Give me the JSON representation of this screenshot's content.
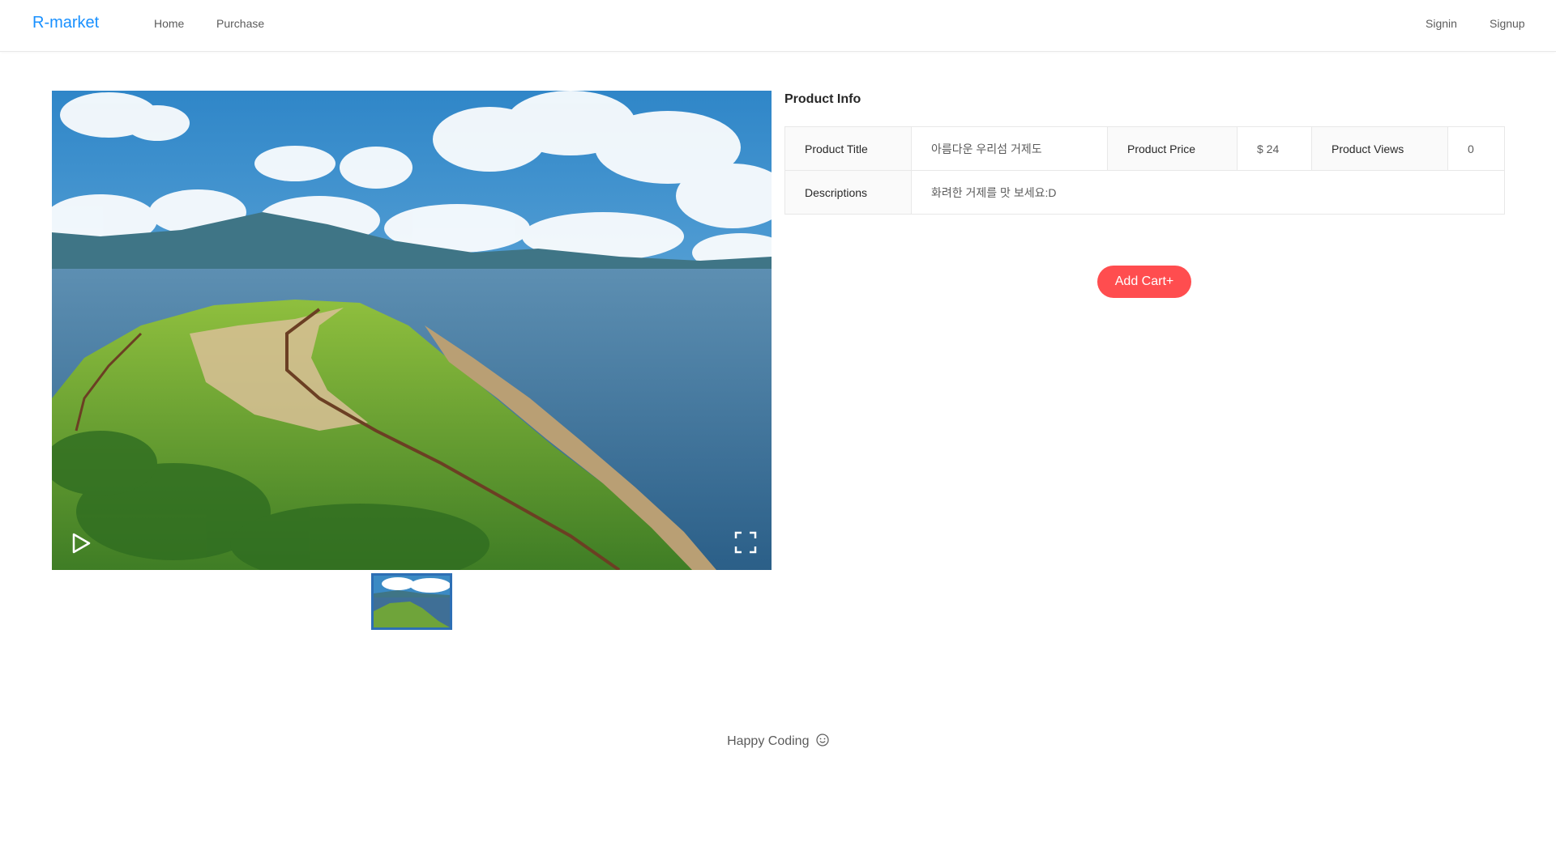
{
  "header": {
    "logo": "R-market",
    "nav": {
      "home": "Home",
      "purchase": "Purchase"
    },
    "auth": {
      "signin": "Signin",
      "signup": "Signup"
    },
    "accent": "#1890ff"
  },
  "media": {
    "play_icon": "play-icon",
    "fullscreen_icon": "fullscreen-icon",
    "thumbnail_selected_color": "#2d6fb5"
  },
  "product": {
    "section_title": "Product Info",
    "title_label": "Product Title",
    "title_value": "아름다운 우리섬 거제도",
    "price_label": "Product Price",
    "price_value": "$ 24",
    "views_label": "Product Views",
    "views_value": "0",
    "desc_label": "Descriptions",
    "desc_value": "화려한 거제를 맛 보세요:D"
  },
  "actions": {
    "add_cart": "Add Cart+",
    "add_cart_color": "#ff4d4f"
  },
  "footer": {
    "text": "Happy Coding",
    "icon": "smile-icon"
  }
}
